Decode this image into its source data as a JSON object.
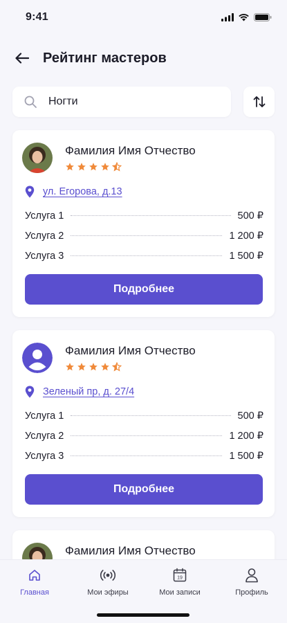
{
  "status_bar": {
    "time": "9:41"
  },
  "header": {
    "title": "Рейтинг мастеров"
  },
  "search": {
    "value": "Ногти"
  },
  "colors": {
    "accent": "#5a4fcf",
    "star": "#f08a3a",
    "background": "#f6f6fb"
  },
  "masters": [
    {
      "name": "Фамилия Имя Отчество",
      "rating": 4.5,
      "avatar": "photo",
      "address": "ул. Егорова, д.13",
      "services": [
        {
          "name": "Услуга 1",
          "price": "500 ₽"
        },
        {
          "name": "Услуга 2",
          "price": "1 200 ₽"
        },
        {
          "name": "Услуга 3",
          "price": "1 500 ₽"
        }
      ],
      "button_label": "Подробнее"
    },
    {
      "name": "Фамилия Имя Отчество",
      "rating": 4.5,
      "avatar": "person-icon",
      "address": "Зеленый пр, д. 27/4",
      "services": [
        {
          "name": "Услуга 1",
          "price": "500 ₽"
        },
        {
          "name": "Услуга 2",
          "price": "1 200 ₽"
        },
        {
          "name": "Услуга 3",
          "price": "1 500 ₽"
        }
      ],
      "button_label": "Подробнее"
    },
    {
      "name": "Фамилия Имя Отчество",
      "avatar": "photo"
    }
  ],
  "tabbar": {
    "items": [
      {
        "label": "Главная",
        "icon": "home-icon",
        "active": true
      },
      {
        "label": "Мои эфиры",
        "icon": "broadcast-icon",
        "active": false
      },
      {
        "label": "Мои записи",
        "icon": "calendar-icon",
        "active": false,
        "calendar_day": "19"
      },
      {
        "label": "Профиль",
        "icon": "profile-icon",
        "active": false
      }
    ]
  }
}
